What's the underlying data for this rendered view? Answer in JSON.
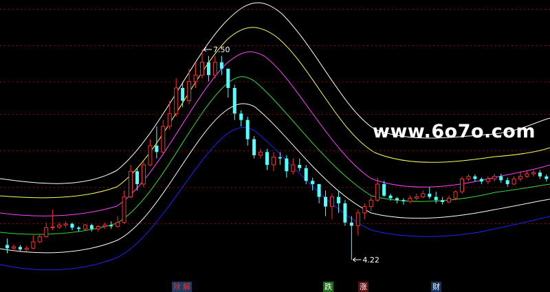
{
  "watermark": "www.6o7o.com",
  "events": [
    {
      "label": "除",
      "bg": "#1c3a5e",
      "color": "#ff2a2a"
    },
    {
      "label": "解",
      "bg": "#1c3a5e",
      "color": "#ff2a2a"
    },
    {
      "label": "跌",
      "bg": "#1f6b1f",
      "color": "#ffffff"
    },
    {
      "label": "涨",
      "bg": "#5a1010",
      "color": "#ffffff"
    },
    {
      "label": "财",
      "bg": "#12305a",
      "color": "#ffffff"
    }
  ],
  "colors": {
    "background": "#000000",
    "grid": "#8b0000",
    "up_candle": "#ff3030",
    "down_candle": "#54ffff",
    "band_white": "#ffffff",
    "band_yellow": "#ffff55",
    "band_magenta": "#ff44ff",
    "band_green": "#33dd33",
    "band_blue": "#2222ff",
    "watermark": "#ffffff"
  },
  "chart_data": {
    "type": "candlestick",
    "price_max_label": "7.50",
    "price_min_label": "4.22",
    "price_max": 7.5,
    "price_min": 4.22,
    "grid": true,
    "band_colors": [
      "white",
      "yellow",
      "magenta",
      "green",
      "white",
      "blue"
    ],
    "candles": [
      [
        4.45,
        4.4,
        4.55,
        4.32
      ],
      [
        4.4,
        4.42,
        4.46,
        4.35
      ],
      [
        4.42,
        4.38,
        4.45,
        4.34
      ],
      [
        4.38,
        4.4,
        4.44,
        4.35
      ],
      [
        4.4,
        4.5,
        4.6,
        4.38
      ],
      [
        4.5,
        4.58,
        4.62,
        4.48
      ],
      [
        4.58,
        4.72,
        4.8,
        4.56
      ],
      [
        4.72,
        4.73,
        5.0,
        4.68
      ],
      [
        4.73,
        4.76,
        4.8,
        4.7
      ],
      [
        4.76,
        4.78,
        4.82,
        4.72
      ],
      [
        4.78,
        4.72,
        4.8,
        4.68
      ],
      [
        4.72,
        4.7,
        4.74,
        4.66
      ],
      [
        4.7,
        4.76,
        4.78,
        4.68
      ],
      [
        4.76,
        4.7,
        4.78,
        4.66
      ],
      [
        4.7,
        4.74,
        4.76,
        4.66
      ],
      [
        4.74,
        4.76,
        4.8,
        4.7
      ],
      [
        4.76,
        4.74,
        4.82,
        4.7
      ],
      [
        4.74,
        4.8,
        4.9,
        4.72
      ],
      [
        4.8,
        5.2,
        5.3,
        4.78
      ],
      [
        5.2,
        5.6,
        5.7,
        5.18
      ],
      [
        5.6,
        5.4,
        5.65,
        5.3
      ],
      [
        5.4,
        5.7,
        5.75,
        5.35
      ],
      [
        5.7,
        6.0,
        6.1,
        5.68
      ],
      [
        6.0,
        5.9,
        6.3,
        5.8
      ],
      [
        5.9,
        6.3,
        6.4,
        5.88
      ],
      [
        6.3,
        6.5,
        6.7,
        6.25
      ],
      [
        6.5,
        6.9,
        7.05,
        6.45
      ],
      [
        6.9,
        6.7,
        7.0,
        6.6
      ],
      [
        6.7,
        7.0,
        7.2,
        6.65
      ],
      [
        7.0,
        7.1,
        7.3,
        6.9
      ],
      [
        7.1,
        7.3,
        7.5,
        7.05
      ],
      [
        7.3,
        7.1,
        7.4,
        7.0
      ],
      [
        7.1,
        7.3,
        7.4,
        7.05
      ],
      [
        7.3,
        7.2,
        7.4,
        7.1
      ],
      [
        7.2,
        6.9,
        7.2,
        6.75
      ],
      [
        6.9,
        6.5,
        6.95,
        6.4
      ],
      [
        6.5,
        6.4,
        6.55,
        6.3
      ],
      [
        6.4,
        6.1,
        6.45,
        6.0
      ],
      [
        6.1,
        5.85,
        6.15,
        5.8
      ],
      [
        5.85,
        5.9,
        5.95,
        5.8
      ],
      [
        5.9,
        5.7,
        5.95,
        5.62
      ],
      [
        5.7,
        5.82,
        5.9,
        5.6
      ],
      [
        5.82,
        5.8,
        5.9,
        5.7
      ],
      [
        5.8,
        5.6,
        5.85,
        5.5
      ],
      [
        5.6,
        5.7,
        5.8,
        5.55
      ],
      [
        5.7,
        5.65,
        5.8,
        5.6
      ],
      [
        5.65,
        5.45,
        5.7,
        5.4
      ],
      [
        5.45,
        5.4,
        5.5,
        5.3
      ],
      [
        5.4,
        5.2,
        5.4,
        5.1
      ],
      [
        5.2,
        5.05,
        5.3,
        4.9
      ],
      [
        5.05,
        5.2,
        5.25,
        4.85
      ],
      [
        5.2,
        5.1,
        5.3,
        4.95
      ],
      [
        5.1,
        4.8,
        5.15,
        4.75
      ],
      [
        4.8,
        4.75,
        4.9,
        4.22
      ],
      [
        4.75,
        4.95,
        5.0,
        4.6
      ],
      [
        4.95,
        5.05,
        5.1,
        4.85
      ],
      [
        5.05,
        5.15,
        5.2,
        4.98
      ],
      [
        5.15,
        5.4,
        5.5,
        5.12
      ],
      [
        5.4,
        5.22,
        5.45,
        5.2
      ],
      [
        5.22,
        5.18,
        5.25,
        5.14
      ],
      [
        5.18,
        5.15,
        5.2,
        5.1
      ],
      [
        5.15,
        5.13,
        5.18,
        5.08
      ],
      [
        5.13,
        5.18,
        5.22,
        5.1
      ],
      [
        5.18,
        5.2,
        5.25,
        5.15
      ],
      [
        5.2,
        5.25,
        5.3,
        5.18
      ],
      [
        5.25,
        5.2,
        5.35,
        5.17
      ],
      [
        5.2,
        5.15,
        5.28,
        5.1
      ],
      [
        5.15,
        5.12,
        5.2,
        5.08
      ],
      [
        5.12,
        5.18,
        5.22,
        5.1
      ],
      [
        5.18,
        5.28,
        5.3,
        5.15
      ],
      [
        5.28,
        5.48,
        5.52,
        5.25
      ],
      [
        5.48,
        5.52,
        5.55,
        5.44
      ],
      [
        5.52,
        5.48,
        5.55,
        5.44
      ],
      [
        5.48,
        5.44,
        5.5,
        5.4
      ],
      [
        5.44,
        5.48,
        5.52,
        5.4
      ],
      [
        5.48,
        5.52,
        5.56,
        5.44
      ],
      [
        5.52,
        5.46,
        5.56,
        5.42
      ],
      [
        5.46,
        5.4,
        5.5,
        5.36
      ],
      [
        5.4,
        5.48,
        5.52,
        5.38
      ],
      [
        5.48,
        5.52,
        5.6,
        5.44
      ],
      [
        5.52,
        5.56,
        5.6,
        5.5
      ],
      [
        5.56,
        5.58,
        5.62,
        5.52
      ],
      [
        5.58,
        5.52,
        5.62,
        5.48
      ],
      [
        5.52,
        5.48,
        5.55,
        5.44
      ]
    ]
  }
}
